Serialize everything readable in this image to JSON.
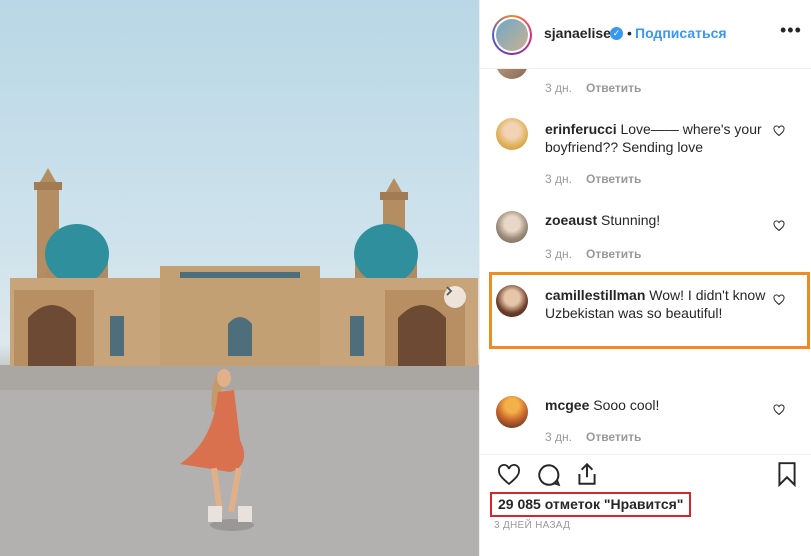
{
  "post": {
    "username": "sjanaelise",
    "separator": "•",
    "follow_label": "Подписаться",
    "more_label": "•••"
  },
  "comments": [
    {
      "username": "",
      "text": "",
      "time": "3 дн.",
      "reply_label": "Ответить"
    },
    {
      "username": "erinferucci",
      "text": "Love—— where's your boyfriend?? Sending love",
      "time": "3 дн.",
      "reply_label": "Ответить"
    },
    {
      "username": "zoeaust",
      "text": "Stunning!",
      "time": "3 дн.",
      "reply_label": "Ответить"
    },
    {
      "username": "camillestillman",
      "text": "Wow! I didn't know Uzbekistan was so beautiful!",
      "time": "",
      "reply_label": ""
    },
    {
      "username": "mcgee",
      "text": "Sooo cool!",
      "time": "3 дн.",
      "reply_label": "Ответить"
    }
  ],
  "likes": {
    "count_text": "29 085 отметок \"Нравится\""
  },
  "time_ago": "3 ДНЕЙ НАЗАД",
  "colors": {
    "accent": "#3897f0",
    "highlight_orange": "#f08a24",
    "highlight_red": "#d9232e"
  },
  "icons": [
    "heart-icon",
    "comment-icon",
    "share-icon",
    "bookmark-icon",
    "chevron-right-icon",
    "verified-badge-icon"
  ]
}
